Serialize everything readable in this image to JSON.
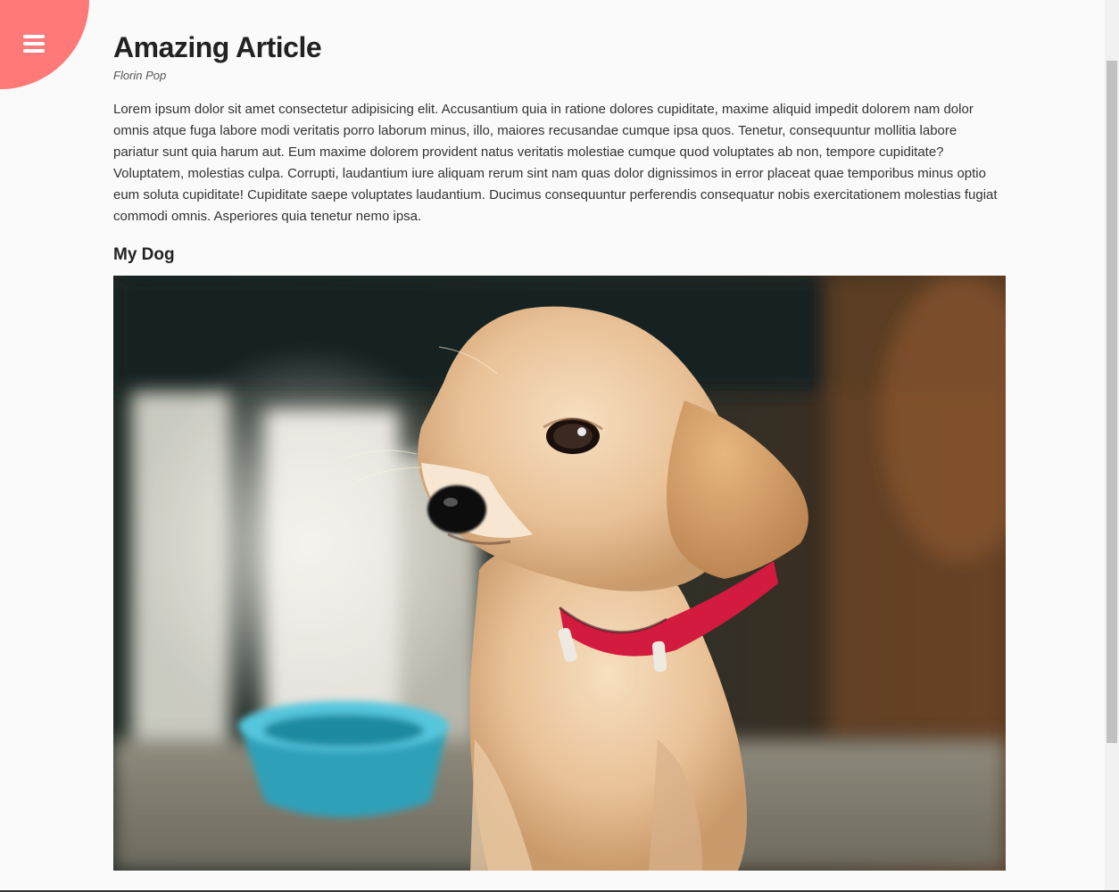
{
  "menu": {
    "icon": "hamburger-menu-icon",
    "color": "#ff7979"
  },
  "article": {
    "title": "Amazing Article",
    "author": "Florin Pop",
    "body": "Lorem ipsum dolor sit amet consectetur adipisicing elit. Accusantium quia in ratione dolores cupiditate, maxime aliquid impedit dolorem nam dolor omnis atque fuga labore modi veritatis porro laborum minus, illo, maiores recusandae cumque ipsa quos. Tenetur, consequuntur mollitia labore pariatur sunt quia harum aut. Eum maxime dolorem provident natus veritatis molestiae cumque quod voluptates ab non, tempore cupiditate? Voluptatem, molestias culpa. Corrupti, laudantium iure aliquam rerum sint nam quas dolor dignissimos in error placeat quae temporibus minus optio eum soluta cupiditate! Cupiditate saepe voluptates laudantium. Ducimus consequuntur perferendis consequatur nobis exercitationem molestias fugiat commodi omnis. Asperiores quia tenetur nemo ipsa.",
    "subheading": "My Dog"
  },
  "photo": {
    "subject": "golden-retriever-puppy-photo"
  }
}
